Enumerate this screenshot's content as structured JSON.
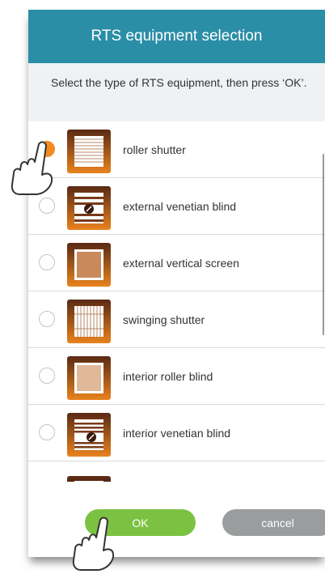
{
  "dialog": {
    "title": "RTS equipment selection",
    "instruction": "Select the type of RTS equipment, then press ‘OK’."
  },
  "equipment": [
    {
      "label": "roller shutter",
      "selected": true,
      "icon": "roller-shutter-icon"
    },
    {
      "label": "external venetian blind",
      "selected": false,
      "icon": "external-venetian-blind-icon"
    },
    {
      "label": "external vertical screen",
      "selected": false,
      "icon": "external-vertical-screen-icon"
    },
    {
      "label": "swinging shutter",
      "selected": false,
      "icon": "swinging-shutter-icon"
    },
    {
      "label": "interior roller blind",
      "selected": false,
      "icon": "interior-roller-blind-icon"
    },
    {
      "label": "interior venetian blind",
      "selected": false,
      "icon": "interior-venetian-blind-icon"
    }
  ],
  "buttons": {
    "ok": "OK",
    "cancel": "cancel"
  },
  "colors": {
    "header": "#2a8ea7",
    "accent": "#f28a1f",
    "ok": "#7cc242",
    "cancel": "#9a9c9e",
    "icon_dark": "#5a2a14",
    "icon_orange": "#e8821e"
  }
}
